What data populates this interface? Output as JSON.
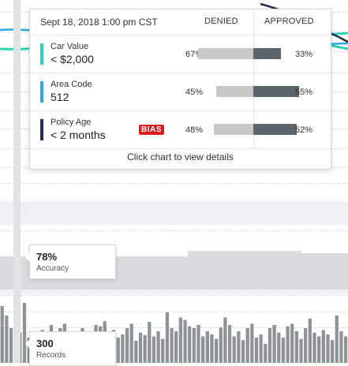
{
  "tooltip": {
    "title": "Sept 18, 2018 1:00 pm CST",
    "denied_header": "DENIED",
    "approved_header": "APPROVED",
    "footer": "Click chart to view details",
    "rows": [
      {
        "label": "Car Value",
        "value": "< $2,000",
        "denied": "67%",
        "approved": "33%",
        "denied_frac": 0.67,
        "approved_frac": 0.33,
        "accent": "#2bd4b4",
        "bias": ""
      },
      {
        "label": "Area Code",
        "value": "512",
        "denied": "45%",
        "approved": "55%",
        "denied_frac": 0.45,
        "approved_frac": 0.55,
        "accent": "#2fa6e8",
        "bias": ""
      },
      {
        "label": "Policy Age",
        "value": "< 2 months",
        "denied": "48%",
        "approved": "52%",
        "denied_frac": 0.48,
        "approved_frac": 0.52,
        "accent": "#243050",
        "bias": "BIAS"
      }
    ]
  },
  "accuracy": {
    "value": "78%",
    "label": "Accuracy"
  },
  "records": {
    "value": "300",
    "label": "Records"
  },
  "colors": {
    "teal": "#2bd4b4",
    "blue": "#2fa6e8",
    "navy": "#243050",
    "bias_red": "#d81e1e",
    "bar_dark": "#5a6469",
    "bar_light": "#c7c9c9",
    "record_bars": "#8c9496"
  },
  "records_histogram": [
    0.9,
    0.75,
    0.55,
    0.62,
    0.48,
    0.95,
    0.4,
    0.35,
    0.45,
    0.52,
    0.38,
    0.6,
    0.44,
    0.55,
    0.62,
    0.5,
    0.48,
    0.4,
    0.55,
    0.5,
    0.45,
    0.6,
    0.58,
    0.66,
    0.5,
    0.52,
    0.4,
    0.45,
    0.55,
    0.62,
    0.35,
    0.48,
    0.44,
    0.65,
    0.42,
    0.5,
    0.38,
    0.8,
    0.55,
    0.5,
    0.72,
    0.68,
    0.58,
    0.55,
    0.6,
    0.42,
    0.5,
    0.45,
    0.38,
    0.56,
    0.72,
    0.6,
    0.42,
    0.5,
    0.36,
    0.55,
    0.62,
    0.4,
    0.45,
    0.3,
    0.55,
    0.6,
    0.48,
    0.4,
    0.58,
    0.62,
    0.5,
    0.38,
    0.55,
    0.7,
    0.48,
    0.42,
    0.52,
    0.45,
    0.36,
    0.75,
    0.5,
    0.42
  ]
}
